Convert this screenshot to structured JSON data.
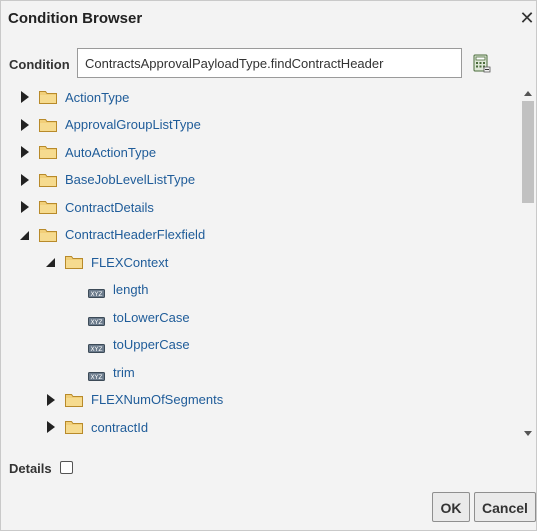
{
  "dialog": {
    "title": "Condition Browser",
    "close_symbol": "✕"
  },
  "condition": {
    "label": "Condition",
    "value": "ContractsApprovalPayloadType.findContractHeader"
  },
  "tree": {
    "items": [
      {
        "label": "ActionType",
        "level": 0,
        "kind": "folder",
        "state": "collapsed"
      },
      {
        "label": "ApprovalGroupListType",
        "level": 0,
        "kind": "folder",
        "state": "collapsed"
      },
      {
        "label": "AutoActionType",
        "level": 0,
        "kind": "folder",
        "state": "collapsed"
      },
      {
        "label": "BaseJobLevelListType",
        "level": 0,
        "kind": "folder",
        "state": "collapsed"
      },
      {
        "label": "ContractDetails",
        "level": 0,
        "kind": "folder",
        "state": "collapsed"
      },
      {
        "label": "ContractHeaderFlexfield",
        "level": 0,
        "kind": "folder",
        "state": "expanded"
      },
      {
        "label": "FLEXContext",
        "level": 1,
        "kind": "folder",
        "state": "expanded"
      },
      {
        "label": "length",
        "level": 2,
        "kind": "method"
      },
      {
        "label": "toLowerCase",
        "level": 2,
        "kind": "method"
      },
      {
        "label": "toUpperCase",
        "level": 2,
        "kind": "method"
      },
      {
        "label": "trim",
        "level": 2,
        "kind": "method"
      },
      {
        "label": "FLEXNumOfSegments",
        "level": 1,
        "kind": "folder",
        "state": "collapsed"
      },
      {
        "label": "contractId",
        "level": 1,
        "kind": "folder",
        "state": "collapsed"
      }
    ]
  },
  "details": {
    "label": "Details",
    "checked": false
  },
  "buttons": {
    "ok_label": "OK",
    "cancel_label": "Cancel"
  },
  "icons": {
    "calculator": "expression-builder-icon",
    "folder": "folder-icon",
    "method": "method-icon",
    "twisty_collapsed": "triangle-right-icon",
    "twisty_expanded": "triangle-down-icon"
  },
  "colors": {
    "link": "#1f5c99",
    "folder": "#e9c46a",
    "background": "#f3f3f3"
  }
}
